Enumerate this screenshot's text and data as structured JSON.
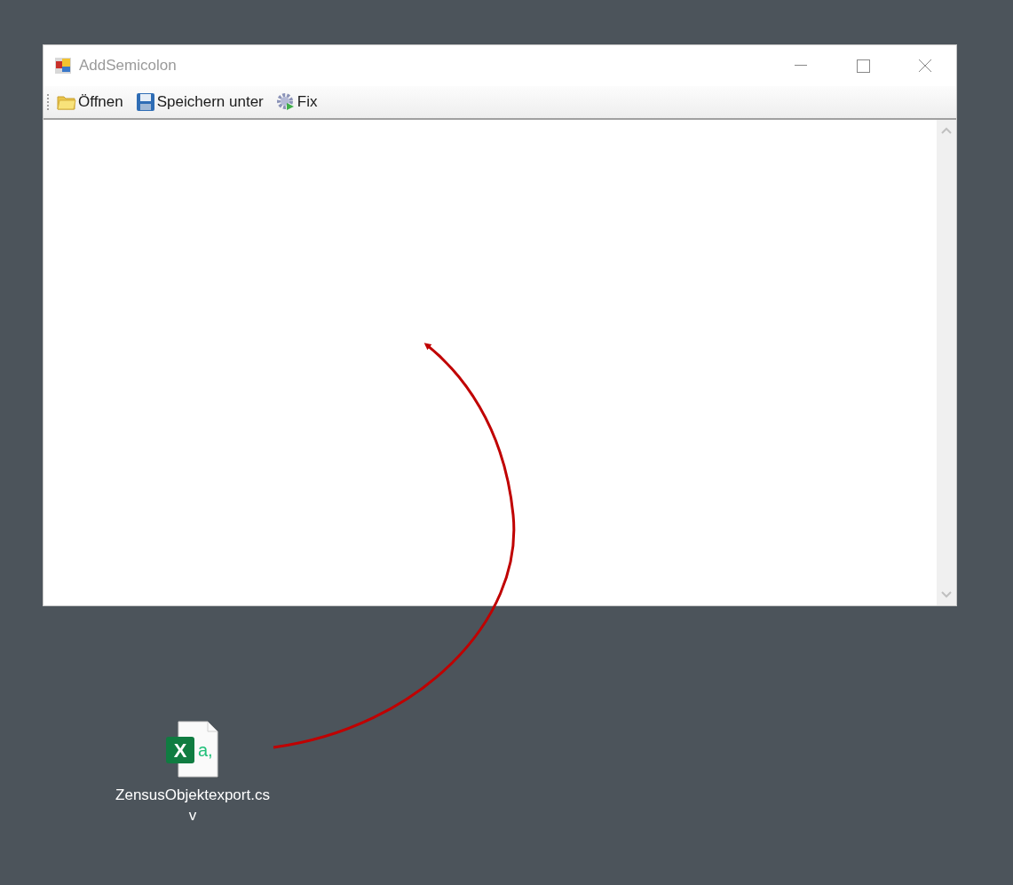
{
  "window": {
    "title": "AddSemicolon"
  },
  "toolbar": [
    {
      "kind": "folder",
      "label": "Öffnen"
    },
    {
      "kind": "save",
      "label": "Speichern unter"
    },
    {
      "kind": "gear",
      "label": "Fix"
    }
  ],
  "desktop_file": {
    "name": "ZensusObjektexport.csv",
    "icon_letters": [
      "X",
      "a,"
    ]
  }
}
